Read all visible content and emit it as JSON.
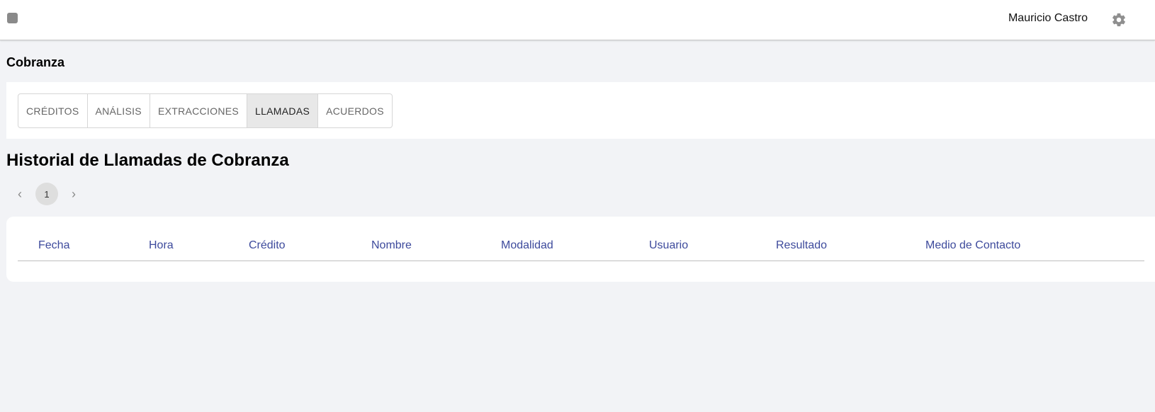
{
  "header": {
    "user_name": "Mauricio Castro",
    "menu_icon": "menu-icon",
    "settings_icon": "gear-icon"
  },
  "section": {
    "title": "Cobranza"
  },
  "tabs": [
    {
      "label": "CRÉDITOS",
      "active": false
    },
    {
      "label": "ANÁLISIS",
      "active": false
    },
    {
      "label": "EXTRACCIONES",
      "active": false
    },
    {
      "label": "LLAMADAS",
      "active": true
    },
    {
      "label": "ACUERDOS",
      "active": false
    }
  ],
  "page": {
    "heading": "Historial de Llamadas de Cobranza"
  },
  "pagination": {
    "current_page": "1",
    "prev_icon": "chevron-left-icon",
    "next_icon": "chevron-right-icon"
  },
  "table": {
    "columns": [
      "Fecha",
      "Hora",
      "Crédito",
      "Nombre",
      "Modalidad",
      "Usuario",
      "Resultado",
      "Medio de Contacto"
    ]
  },
  "colors": {
    "header_text": "#3d4a9c",
    "background": "#f2f3f6",
    "active_tab": "#e8e8e8"
  }
}
